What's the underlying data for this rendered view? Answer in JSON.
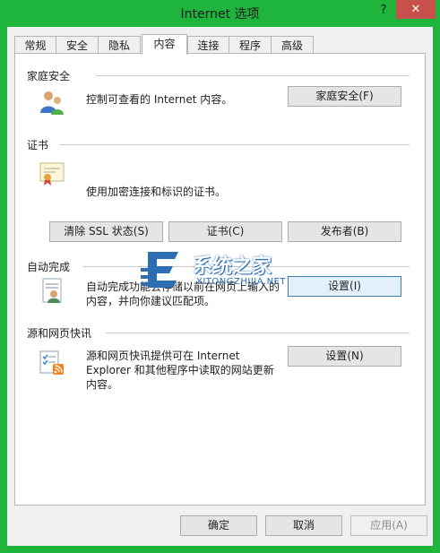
{
  "window": {
    "title": "Internet 选项",
    "help": "?",
    "close": "✕"
  },
  "tabs": [
    {
      "label": "常规"
    },
    {
      "label": "安全"
    },
    {
      "label": "隐私"
    },
    {
      "label": "内容"
    },
    {
      "label": "连接"
    },
    {
      "label": "程序"
    },
    {
      "label": "高级"
    }
  ],
  "sections": {
    "family": {
      "title": "家庭安全",
      "desc": "控制可查看的 Internet 内容。",
      "button": "家庭安全(F)"
    },
    "cert": {
      "title": "证书",
      "desc": "使用加密连接和标识的证书。",
      "buttons": {
        "clear_ssl": "清除 SSL 状态(S)",
        "certs": "证书(C)",
        "publishers": "发布者(B)"
      }
    },
    "autocomplete": {
      "title": "自动完成",
      "desc1": "自动完成功能会存储以前在网页上输入的",
      "desc2": "内容，并向你建议匹配项。",
      "button": "设置(I)"
    },
    "feeds": {
      "title": "源和网页快讯",
      "desc1": "源和网页快讯提供可在 Internet",
      "desc2": "Explorer 和其他程序中读取的网站更新",
      "desc3": "内容。",
      "button": "设置(N)"
    }
  },
  "footer": {
    "ok": "确定",
    "cancel": "取消",
    "apply": "应用(A)"
  },
  "watermark": {
    "text": "系统之家",
    "sub": "XITONGZHIJIA.NET"
  }
}
